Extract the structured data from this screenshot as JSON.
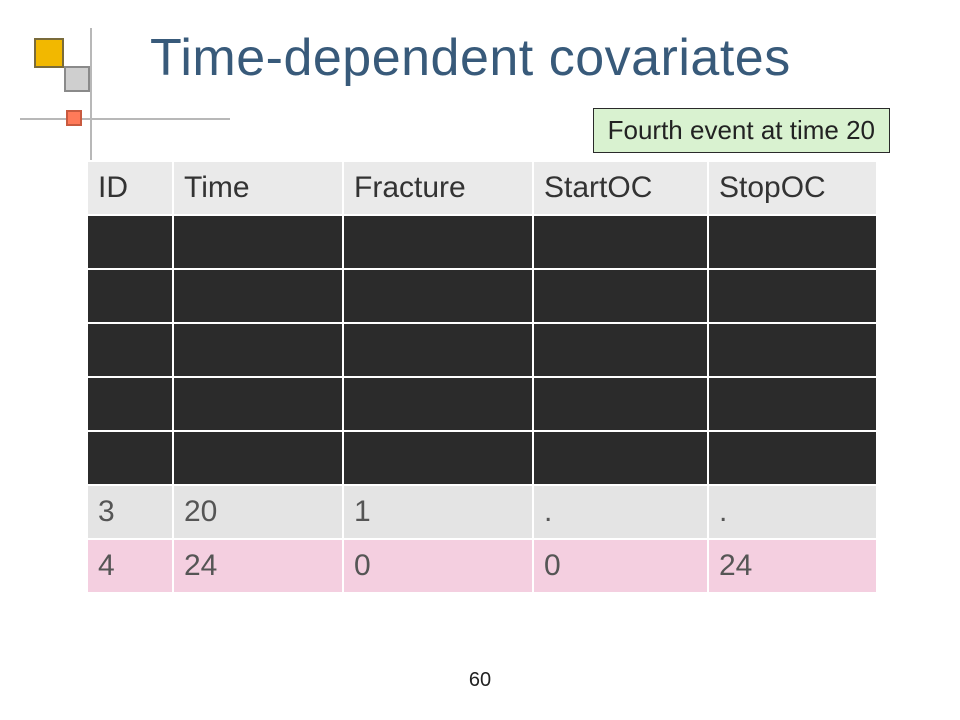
{
  "title": "Time-dependent covariates",
  "callout": "Fourth event at time 20",
  "page_number": "60",
  "table": {
    "headers": [
      "ID",
      "Time",
      "Fracture",
      "StartOC",
      "StopOC"
    ],
    "dark_row_count": 5,
    "rows": [
      {
        "style": "gray",
        "cells": [
          "3",
          "20",
          "1",
          ".",
          "."
        ]
      },
      {
        "style": "pink",
        "cells": [
          "4",
          "24",
          "0",
          "0",
          "24"
        ]
      }
    ]
  }
}
